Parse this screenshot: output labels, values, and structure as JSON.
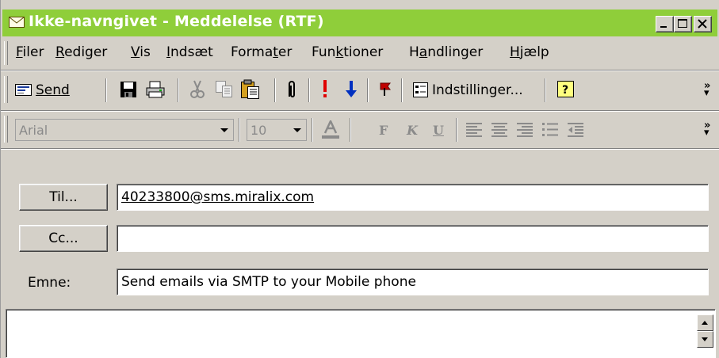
{
  "window": {
    "title": "Ikke-navngivet - Meddelelse (RTF)",
    "title_bar_color": "#8fce3a",
    "controls": [
      "minimize-icon",
      "maximize-icon",
      "close-icon"
    ]
  },
  "menu": {
    "items": [
      {
        "label": "Filer"
      },
      {
        "label": "Rediger"
      },
      {
        "label": "Vis"
      },
      {
        "label": "Indsæt"
      },
      {
        "label": "Formater"
      },
      {
        "label": "Funktioner"
      },
      {
        "label": "Handlinger"
      },
      {
        "label": "Hjælp"
      }
    ]
  },
  "standard_toolbar": {
    "send_label": "Send",
    "options_label": "Indstillinger...",
    "icons": [
      "send-icon",
      "save-icon",
      "print-icon",
      "cut-icon",
      "copy-icon",
      "paste-icon",
      "attach-icon",
      "high-importance-icon",
      "low-importance-icon",
      "flag-icon",
      "options-icon",
      "help-icon",
      "more-icon"
    ]
  },
  "formatting_toolbar": {
    "font": "Arial",
    "size": "10",
    "bold": "F",
    "italic": "K",
    "underline": "U",
    "icons": [
      "font-color-icon",
      "align-left-icon",
      "align-center-icon",
      "align-right-icon",
      "bullets-icon",
      "decrease-indent-icon",
      "more-icon"
    ]
  },
  "fields": {
    "to_button": "Til...",
    "to_value": "40233800@sms.miralix.com",
    "cc_button": "Cc...",
    "cc_value": "",
    "subject_label": "Emne:",
    "subject_value": "Send emails via SMTP to your Mobile phone"
  }
}
